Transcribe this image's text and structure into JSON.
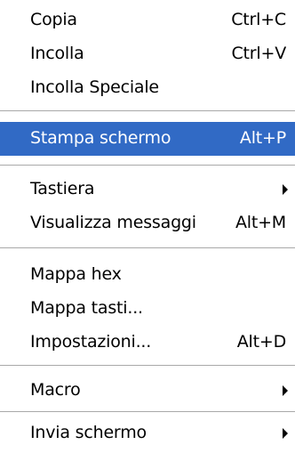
{
  "menu": {
    "colors": {
      "background": "#ffffff",
      "highlight": "#316ac5",
      "separator": "#a9a9a9"
    },
    "items": [
      {
        "label": "Copia",
        "shortcut": "Ctrl+C"
      },
      {
        "label": "Incolla",
        "shortcut": "Ctrl+V"
      },
      {
        "label": "Incolla Speciale",
        "shortcut": ""
      },
      {
        "label": "Stampa schermo",
        "shortcut": "Alt+P",
        "highlighted": true
      },
      {
        "label": "Tastiera",
        "shortcut": "",
        "submenu": true,
        "icon": "chevron-right-icon"
      },
      {
        "label": "Visualizza messaggi",
        "shortcut": "Alt+M"
      },
      {
        "label": "Mappa hex",
        "shortcut": ""
      },
      {
        "label": "Mappa tasti...",
        "shortcut": ""
      },
      {
        "label": "Impostazioni...",
        "shortcut": "Alt+D"
      },
      {
        "label": "Macro",
        "shortcut": "",
        "submenu": true,
        "icon": "chevron-right-icon"
      },
      {
        "label": "Invia schermo",
        "shortcut": "",
        "submenu": true,
        "icon": "chevron-right-icon"
      }
    ]
  }
}
